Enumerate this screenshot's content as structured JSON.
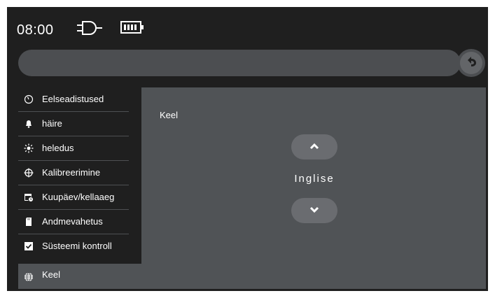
{
  "status": {
    "time": "08:00"
  },
  "sidebar": {
    "items": [
      {
        "label": "Eelseadistused",
        "icon": "preset-dial-icon"
      },
      {
        "label": "häire",
        "icon": "bell-icon"
      },
      {
        "label": "heledus",
        "icon": "brightness-icon"
      },
      {
        "label": "Kalibreerimine",
        "icon": "crosshair-icon"
      },
      {
        "label": "Kuupäev/kellaaeg",
        "icon": "calendar-clock-icon"
      },
      {
        "label": "Andmevahetus",
        "icon": "sd-card-icon"
      },
      {
        "label": "Süsteemi kontroll",
        "icon": "checkbox-icon"
      }
    ],
    "active": {
      "label": "Keel",
      "icon": "globe-icon"
    }
  },
  "content": {
    "title": "Keel",
    "value": "Inglise"
  },
  "colors": {
    "screen_bg": "#1f1f1f",
    "panel_bg": "#505356",
    "bar_bg": "#4c4e51",
    "button_bg": "#6a6c70",
    "text": "#ffffff"
  }
}
